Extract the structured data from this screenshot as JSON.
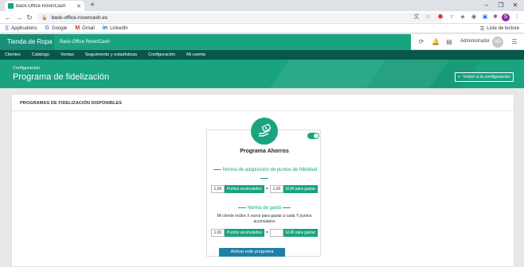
{
  "browser": {
    "tab_title": "Back-Office RoverCash",
    "url": "back-office-rovercash.es",
    "bookmarks": [
      {
        "label": "Applications",
        "icon": "apps-grid-icon"
      },
      {
        "label": "Google",
        "icon": "google-icon"
      },
      {
        "label": "Gmail",
        "icon": "gmail-icon"
      },
      {
        "label": "LinkedIn",
        "icon": "linkedin-icon"
      }
    ],
    "reading_list": "Liste de lecture",
    "profile_initial": "S"
  },
  "app": {
    "brand": "Tienda de Ropa",
    "shop_name": "Back-Office RoverCash",
    "user": "Administrador",
    "avatar_initials": "AD",
    "nav": [
      "Clientes",
      "Catálogo",
      "Ventas",
      "Seguimiento y estadísticas",
      "Configuración",
      "Mi cuenta"
    ]
  },
  "page": {
    "breadcrumb": "Configuración",
    "title": "Programa de fidelización",
    "back_button": "Volver a la configuración",
    "section_title": "PROGRAMAS DE FIDELIZACIÓN DISPONIBLES"
  },
  "program": {
    "name": "Programa Ahorros",
    "enabled": true,
    "rule1_title": "Norma de adquisición de puntos de fidelidad",
    "rule1_points_value": "1,00",
    "rule1_points_label": "Puntos acumulados",
    "rule1_eq": "=",
    "rule1_eur_value": "1,00",
    "rule1_eur_label": "EUR para gastar",
    "rule2_title": "Norma de gasto",
    "rule2_desc": "Mi cliente recibe X euros para gastar a cada Y puntos acumulados",
    "rule2_points_value": "1,00",
    "rule2_points_label": "Puntos acumulados",
    "rule2_eq": "=",
    "rule2_eur_value": "",
    "rule2_eur_label": "EUR para gastar",
    "activate_button": "Activar este programa"
  },
  "colors": {
    "primary": "#1aa37f",
    "dark_nav": "#07574a",
    "button_blue": "#1f7fa6"
  }
}
